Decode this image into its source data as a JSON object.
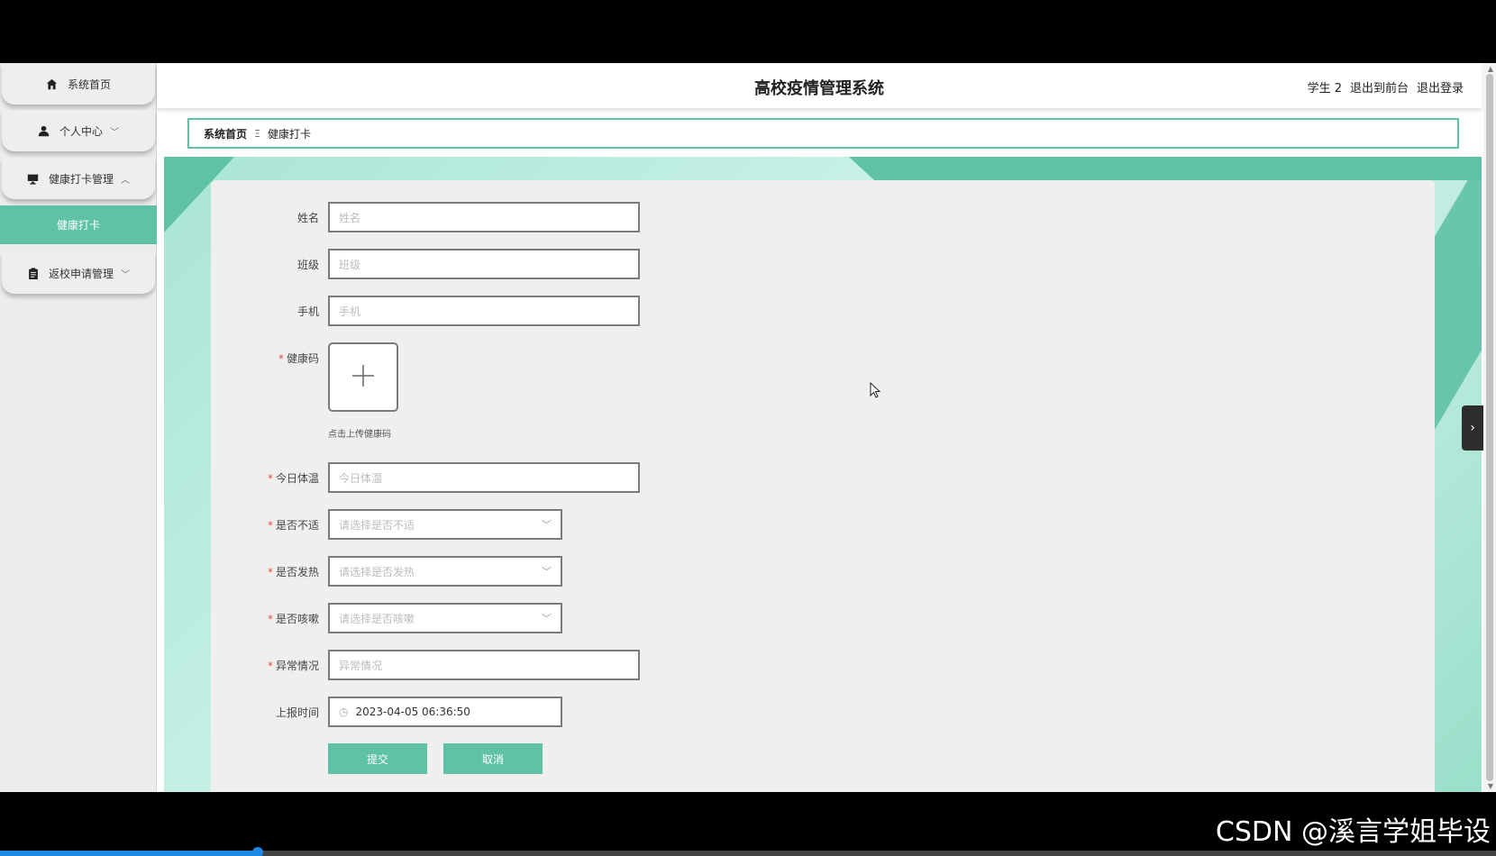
{
  "sidebar": {
    "items": [
      {
        "label": "系统首页",
        "icon": "home-icon"
      },
      {
        "label": "个人中心",
        "icon": "user-icon"
      },
      {
        "label": "健康打卡管理",
        "icon": "monitor-icon"
      },
      {
        "label": "健康打卡",
        "icon": ""
      },
      {
        "label": "返校申请管理",
        "icon": "clipboard-icon"
      }
    ]
  },
  "header": {
    "title": "高校疫情管理系统",
    "user": "学生 2",
    "front_link": "退出到前台",
    "logout_link": "退出登录"
  },
  "breadcrumb": {
    "home": "系统首页",
    "separator": "Ξ",
    "current": "健康打卡"
  },
  "form": {
    "name": {
      "label": "姓名",
      "placeholder": "姓名"
    },
    "class": {
      "label": "班级",
      "placeholder": "班级"
    },
    "phone": {
      "label": "手机",
      "placeholder": "手机"
    },
    "health_code": {
      "label": "健康码",
      "hint": "点击上传健康码"
    },
    "temperature": {
      "label": "今日体温",
      "placeholder": "今日体温"
    },
    "discomfort": {
      "label": "是否不适",
      "placeholder": "请选择是否不适"
    },
    "fever": {
      "label": "是否发热",
      "placeholder": "请选择是否发热"
    },
    "cough": {
      "label": "是否咳嗽",
      "placeholder": "请选择是否咳嗽"
    },
    "abnormal": {
      "label": "异常情况",
      "placeholder": "异常情况"
    },
    "report_time": {
      "label": "上报时间",
      "value": "2023-04-05 06:36:50"
    },
    "submit_label": "提交",
    "cancel_label": "取消"
  },
  "watermark": "CSDN @溪言学姐毕设",
  "video_progress": 0.172,
  "colors": {
    "accent": "#5fc1a6",
    "required": "#e0513e",
    "content_bg": "#c9f1e8"
  }
}
